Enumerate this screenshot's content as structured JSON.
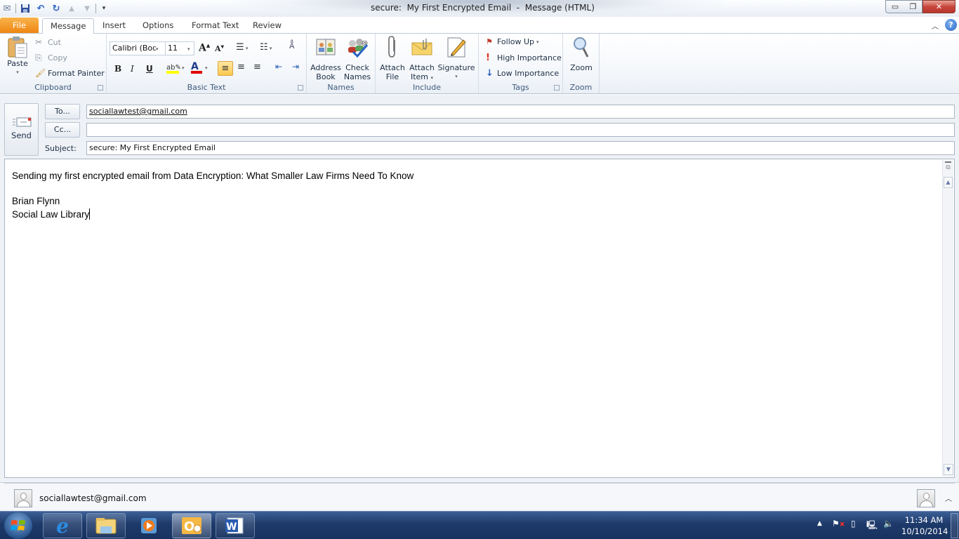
{
  "window": {
    "title": "secure:  My First Encrypted Email  -  Message (HTML)",
    "controls": {
      "minimize": "minimize",
      "restore": "restore",
      "close": "close"
    }
  },
  "quick_access": {
    "icons": [
      "outlook-message-icon",
      "save-icon",
      "undo-icon",
      "redo-icon",
      "previous-item-icon",
      "next-item-icon",
      "customize-qat-icon"
    ]
  },
  "tabs": [
    {
      "label": "File"
    },
    {
      "label": "Message",
      "active": true
    },
    {
      "label": "Insert"
    },
    {
      "label": "Options"
    },
    {
      "label": "Format Text"
    },
    {
      "label": "Review"
    }
  ],
  "ribbon": {
    "clipboard": {
      "label": "Clipboard",
      "paste": "Paste",
      "cut": "Cut",
      "copy": "Copy",
      "format_painter": "Format Painter"
    },
    "basic_text": {
      "label": "Basic Text",
      "font_name": "Calibri (Body)",
      "font_size": "11",
      "highlight_color": "#ffff00",
      "font_color": "#e00000"
    },
    "names": {
      "label": "Names",
      "address_book": [
        "Address",
        "Book"
      ],
      "check_names": [
        "Check",
        "Names"
      ]
    },
    "include": {
      "label": "Include",
      "attach_file": [
        "Attach",
        "File"
      ],
      "attach_item": [
        "Attach",
        "Item"
      ],
      "signature": "Signature"
    },
    "tags": {
      "label": "Tags",
      "follow_up": "Follow Up",
      "high_importance": "High Importance",
      "low_importance": "Low Importance"
    },
    "zoom": {
      "label": "Zoom",
      "zoom_button": "Zoom"
    }
  },
  "compose": {
    "send_label": "Send",
    "to_button": "To...",
    "cc_button": "Cc...",
    "subject_label": "Subject:",
    "to_value": "sociallawtest@gmail.com",
    "cc_value": "",
    "subject_value": "secure:  My First Encrypted Email",
    "body_lines": [
      "Sending my first encrypted email from Data Encryption:  What Smaller Law Firms Need To Know",
      "",
      "Brian Flynn",
      "Social Law Library"
    ]
  },
  "people_pane": {
    "contact": "sociallawtest@gmail.com"
  },
  "taskbar": {
    "apps": [
      "start-button",
      "internet-explorer",
      "windows-explorer",
      "media-player",
      "outlook",
      "word"
    ],
    "time": "11:34 AM",
    "date": "10/10/2014"
  },
  "colors": {
    "file_tab": "#ee8613",
    "accent": "#1e395b",
    "close_button": "#c9463d",
    "taskbar": "#1e3a6a"
  }
}
